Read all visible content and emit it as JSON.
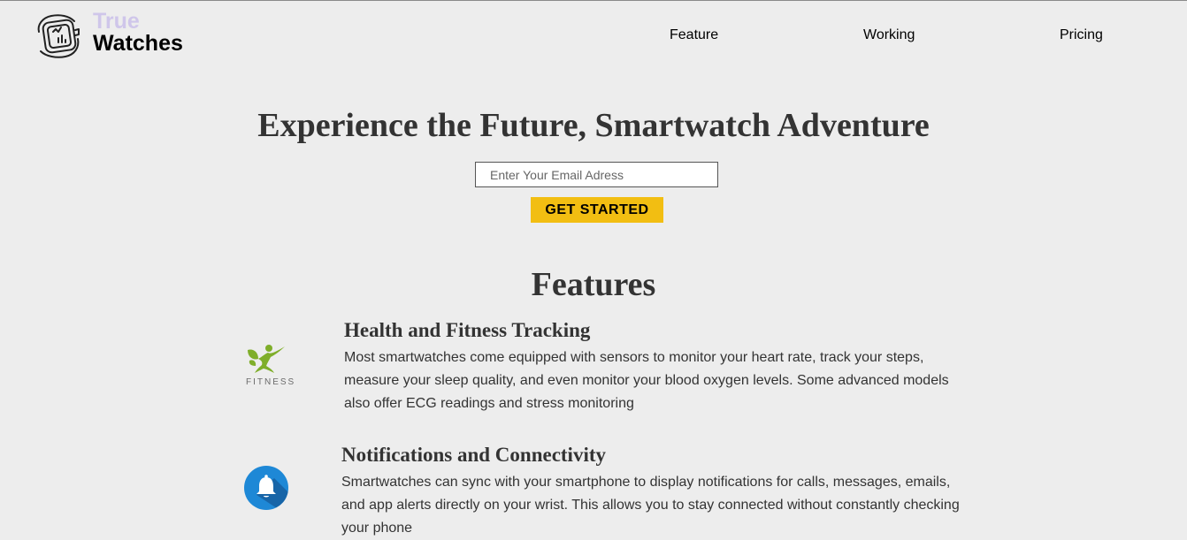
{
  "header": {
    "brand_line1": "True",
    "brand_line2": "Watches",
    "logo_icon": "smartwatch-icon",
    "nav": [
      {
        "label": "Feature"
      },
      {
        "label": "Working"
      },
      {
        "label": "Pricing"
      }
    ]
  },
  "hero": {
    "title": "Experience the Future, Smartwatch Adventure",
    "email_placeholder": "Enter Your Email Adress",
    "email_value": "",
    "cta_label": "GET STARTED"
  },
  "features": {
    "title": "Features",
    "items": [
      {
        "icon": "fitness-icon",
        "icon_label": "FITNESS",
        "heading": "Health and Fitness Tracking",
        "text": "Most smartwatches come equipped with sensors to monitor your heart rate, track your steps, measure your sleep quality, and even monitor your blood oxygen levels. Some advanced models also offer ECG readings and stress monitoring"
      },
      {
        "icon": "bell-icon",
        "heading": "Notifications and Connectivity",
        "text": "Smartwatches can sync with your smartphone to display notifications for calls, messages, emails, and app alerts directly on your wrist. This allows you to stay connected without constantly checking your phone"
      }
    ]
  },
  "colors": {
    "background": "#ededed",
    "brand_accent": "#cfc6ea",
    "cta": "#f2be12",
    "fitness_green": "#7fae2a",
    "bell_blue": "#1e88d6"
  }
}
